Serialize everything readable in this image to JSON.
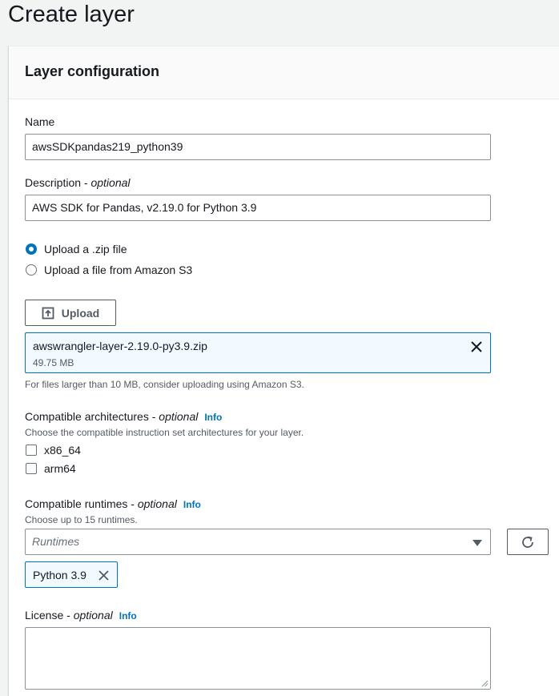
{
  "page": {
    "title": "Create layer"
  },
  "panel": {
    "title": "Layer configuration"
  },
  "name": {
    "label": "Name",
    "value": "awsSDKpandas219_python39"
  },
  "description": {
    "label": "Description",
    "optional": "optional",
    "value": "AWS SDK for Pandas, v2.19.0 for Python 3.9"
  },
  "upload_options": {
    "zip_label": "Upload a .zip file",
    "s3_label": "Upload a file from Amazon S3",
    "selected": "zip"
  },
  "upload": {
    "button_label": "Upload",
    "file_name": "awswrangler-layer-2.19.0-py3.9.zip",
    "file_size": "49.75 MB",
    "hint": "For files larger than 10 MB, consider uploading using Amazon S3."
  },
  "architectures": {
    "label": "Compatible architectures",
    "optional": "optional",
    "info": "Info",
    "description": "Choose the compatible instruction set architectures for your layer.",
    "options": [
      "x86_64",
      "arm64"
    ]
  },
  "runtimes": {
    "label": "Compatible runtimes",
    "optional": "optional",
    "info": "Info",
    "description": "Choose up to 15 runtimes.",
    "placeholder": "Runtimes",
    "selected": [
      "Python 3.9"
    ]
  },
  "license": {
    "label": "License",
    "optional": "optional",
    "info": "Info",
    "value": ""
  },
  "colors": {
    "accent": "#0073bb",
    "border": "#879196",
    "token_bg": "#f1faff"
  }
}
